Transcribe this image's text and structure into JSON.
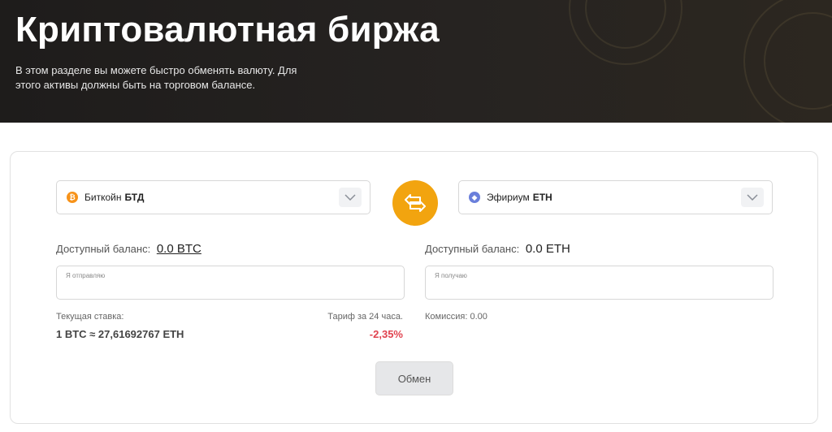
{
  "hero": {
    "title": "Криптовалютная биржа",
    "description": "В этом разделе вы можете быстро обменять валюту. Для этого активы должны быть на торговом балансе."
  },
  "send": {
    "coin_name": "Биткойн",
    "coin_ticker": "БТД",
    "icon": "bitcoin-icon",
    "icon_color": "#f7931a",
    "balance_label": "Доступный баланс:",
    "balance_value": "0.0 BTC",
    "placeholder": "Я отправляю",
    "value": ""
  },
  "receive": {
    "coin_name": "Эфириум",
    "coin_ticker": "ETH",
    "icon": "ethereum-icon",
    "icon_color": "#6a7fdb",
    "balance_label": "Доступный баланс:",
    "balance_value": "0.0 ETH",
    "placeholder": "Я получаю",
    "value": ""
  },
  "swap": {
    "icon": "swap-arrows-icon",
    "color": "#f2a40f"
  },
  "rate": {
    "label": "Текущая ставка:",
    "value": "1 BTC ≈ 27,61692767 ETH",
    "change_label": "Тариф за 24 часа.",
    "change_value": "-2,35%",
    "change_color": "#e0424e"
  },
  "commission": {
    "label": "Комиссия: 0.00"
  },
  "exchange_button": {
    "label": "Обмен"
  }
}
